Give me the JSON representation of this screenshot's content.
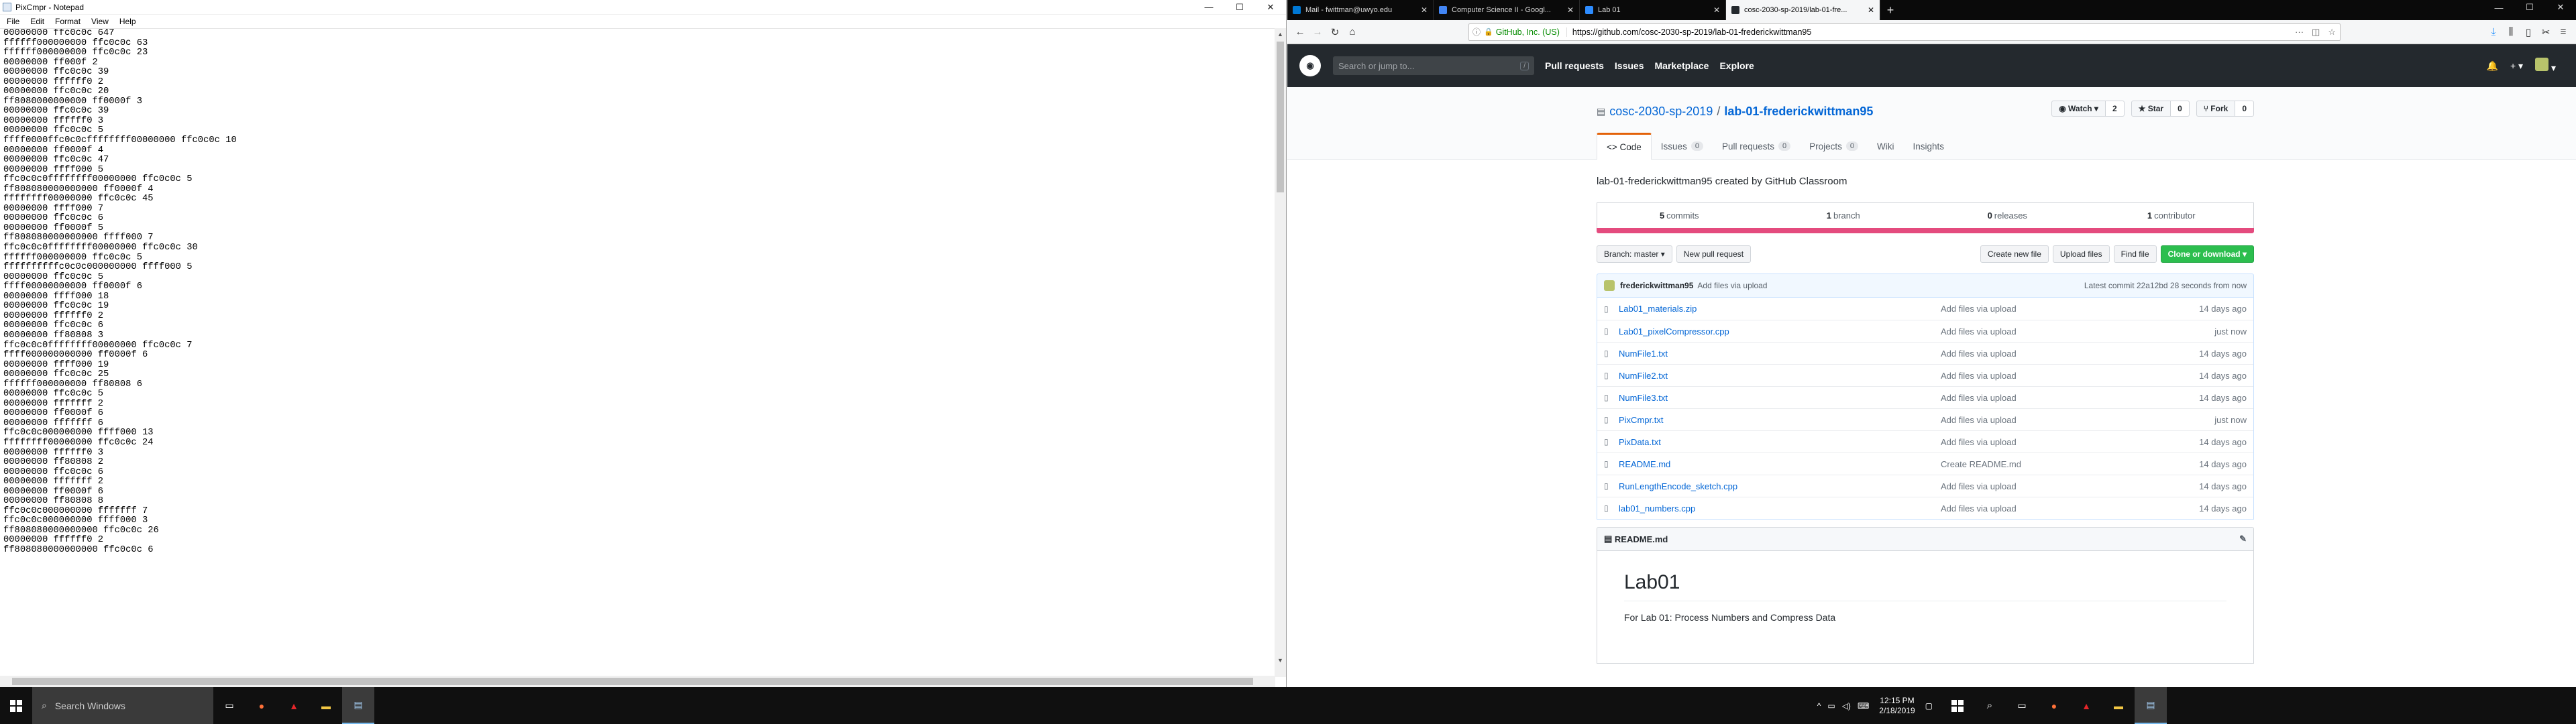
{
  "notepad": {
    "title": "PixCmpr - Notepad",
    "menu": [
      "File",
      "Edit",
      "Format",
      "View",
      "Help"
    ],
    "lines": [
      "00000000 ffc0c0c 647",
      "ffffff000000000 ffc0c0c 63",
      "ffffff000000000 ffc0c0c 23",
      "00000000 ff000f 2",
      "00000000 ffc0c0c 39",
      "00000000 ffffff0 2",
      "00000000 ffc0c0c 20",
      "ff8080000000000 ff0000f 3",
      "00000000 ffc0c0c 39",
      "00000000 ffffff0 3",
      "00000000 ffc0c0c 5",
      "ffff0000ffc0c0cffffffff00000000 ffc0c0c 10",
      "00000000 ff0000f 4",
      "00000000 ffc0c0c 47",
      "00000000 ffff000 5",
      "ffc0c0c0ffffffff00000000 ffc0c0c 5",
      "ff808080000000000 ff0000f 4",
      "ffffffff00000000 ffc0c0c 45",
      "00000000 ffff000 7",
      "00000000 ffc0c0c 6",
      "00000000 ff0000f 5",
      "ff808080000000000 ffff000 7",
      "ffc0c0c0ffffffff00000000 ffc0c0c 30",
      "ffffff000000000 ffc0c0c 5",
      "ffffffffffc0c0c000000000 ffff000 5",
      "00000000 ffc0c0c 5",
      "ffff00000000000 ff0000f 6",
      "00000000 ffff000 18",
      "00000000 ffc0c0c 19",
      "00000000 ffffff0 2",
      "00000000 ffc0c0c 6",
      "00000000 ff80808 3",
      "ffc0c0c0ffffffff00000000 ffc0c0c 7",
      "ffff000000000000 ff0000f 6",
      "00000000 ffff000 19",
      "00000000 ffc0c0c 25",
      "ffffff000000000 ff80808 6",
      "00000000 ffc0c0c 5",
      "00000000 fffffff 2",
      "00000000 ff0000f 6",
      "00000000 fffffff 6",
      "ffc0c0c000000000 ffff000 13",
      "ffffffff00000000 ffc0c0c 24",
      "00000000 ffffff0 3",
      "00000000 ff80808 2",
      "00000000 ffc0c0c 6",
      "00000000 fffffff 2",
      "00000000 ff0000f 6",
      "00000000 ff80808 8",
      "ffc0c0c000000000 fffffff 7",
      "ffc0c0c000000000 ffff000 3",
      "ff808080000000000 ffc0c0c 26",
      "00000000 ffffff0 2",
      "ff808080000000000 ffc0c0c 6"
    ]
  },
  "browser": {
    "tabs": [
      {
        "label": "Mail - fwittman@uwyo.edu",
        "color": "#0078d4"
      },
      {
        "label": "Computer Science II - Googl...",
        "color": "#4285f4"
      },
      {
        "label": "Lab 01",
        "color": "#2d8cff"
      },
      {
        "label": "cosc-2030-sp-2019/lab-01-fre...",
        "color": "#24292e"
      }
    ],
    "new_tab": "+",
    "url_identity": "GitHub, Inc. (US)",
    "url": "https://github.com/cosc-2030-sp-2019/lab-01-frederickwittman95",
    "url_more": "···"
  },
  "github": {
    "search_placeholder": "Search or jump to...",
    "search_key": "/",
    "nav": [
      "Pull requests",
      "Issues",
      "Marketplace",
      "Explore"
    ],
    "owner": "cosc-2030-sp-2019",
    "repo": "lab-01-frederickwittman95",
    "watch": {
      "label": "◉ Watch ▾",
      "count": "2"
    },
    "star": {
      "label": "★ Star",
      "count": "0"
    },
    "fork": {
      "label": "⑂ Fork",
      "count": "0"
    },
    "tabs": [
      {
        "label": "<> Code",
        "count": ""
      },
      {
        "label": "Issues",
        "count": "0"
      },
      {
        "label": "Pull requests",
        "count": "0"
      },
      {
        "label": "Projects",
        "count": "0"
      },
      {
        "label": "Wiki",
        "count": ""
      },
      {
        "label": "Insights",
        "count": ""
      }
    ],
    "description": "lab-01-frederickwittman95 created by GitHub Classroom",
    "stats": {
      "commits_n": "5",
      "commits": "commits",
      "branches_n": "1",
      "branches": "branch",
      "releases_n": "0",
      "releases": "releases",
      "contributors_n": "1",
      "contributors": "contributor"
    },
    "branch_btn": "Branch: master ▾",
    "new_pr": "New pull request",
    "create_file": "Create new file",
    "upload_files": "Upload files",
    "find_file": "Find file",
    "clone": "Clone or download ▾",
    "commit": {
      "author": "frederickwittman95",
      "message": "Add files via upload",
      "latest": "Latest commit 22a12bd 28 seconds from now"
    },
    "files": [
      {
        "name": "Lab01_materials.zip",
        "msg": "Add files via upload",
        "age": "14 days ago"
      },
      {
        "name": "Lab01_pixelCompressor.cpp",
        "msg": "Add files via upload",
        "age": "just now"
      },
      {
        "name": "NumFile1.txt",
        "msg": "Add files via upload",
        "age": "14 days ago"
      },
      {
        "name": "NumFile2.txt",
        "msg": "Add files via upload",
        "age": "14 days ago"
      },
      {
        "name": "NumFile3.txt",
        "msg": "Add files via upload",
        "age": "14 days ago"
      },
      {
        "name": "PixCmpr.txt",
        "msg": "Add files via upload",
        "age": "just now"
      },
      {
        "name": "PixData.txt",
        "msg": "Add files via upload",
        "age": "14 days ago"
      },
      {
        "name": "README.md",
        "msg": "Create README.md",
        "age": "14 days ago"
      },
      {
        "name": "RunLengthEncode_sketch.cpp",
        "msg": "Add files via upload",
        "age": "14 days ago"
      },
      {
        "name": "lab01_numbers.cpp",
        "msg": "Add files via upload",
        "age": "14 days ago"
      }
    ],
    "readme_label": "README.md",
    "readme_title": "Lab01",
    "readme_body": "For Lab 01: Process Numbers and Compress Data"
  },
  "taskbar": {
    "search": "Search Windows",
    "time": "12:15 PM",
    "date": "2/18/2019"
  }
}
